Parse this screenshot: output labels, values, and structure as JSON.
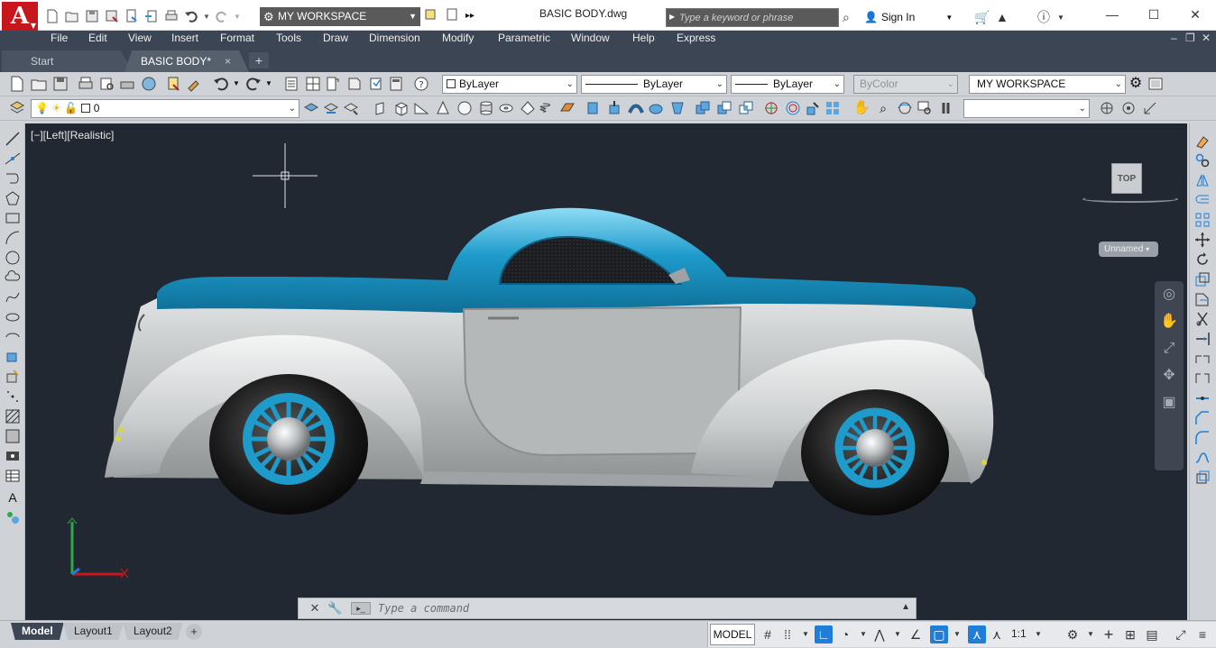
{
  "titlebar": {
    "app_letter": "A",
    "workspace": "MY WORKSPACE",
    "file_title": "BASIC BODY.dwg",
    "search_placeholder": "Type a keyword or phrase",
    "sign_in": "Sign In"
  },
  "menu": {
    "items": [
      "File",
      "Edit",
      "View",
      "Insert",
      "Format",
      "Tools",
      "Draw",
      "Dimension",
      "Modify",
      "Parametric",
      "Window",
      "Help",
      "Express"
    ]
  },
  "doc_tabs": {
    "start": "Start",
    "active": "BASIC BODY*",
    "close_glyph": "×",
    "new_glyph": "+"
  },
  "properties": {
    "color": "ByLayer",
    "linetype": "ByLayer",
    "lineweight": "ByLayer",
    "plotstyle": "ByColor",
    "workspace": "MY WORKSPACE",
    "layer": "0"
  },
  "viewport": {
    "label": "[−][Left][Realistic]",
    "viewcube_face": "TOP",
    "ucs_name": "Unnamed",
    "command_placeholder": "Type a command"
  },
  "layouts": {
    "tabs": [
      "Model",
      "Layout1",
      "Layout2"
    ],
    "active": "Model",
    "add_glyph": "+"
  },
  "status": {
    "model": "MODEL",
    "scale": "1:1"
  },
  "colors": {
    "app_red": "#c8161d",
    "dark_chrome": "#3b4553",
    "viewport_bg": "#212831",
    "car_roof": "#1e9bcb",
    "car_body": "#b8bcbd",
    "accent_blue": "#1f7fd8"
  }
}
